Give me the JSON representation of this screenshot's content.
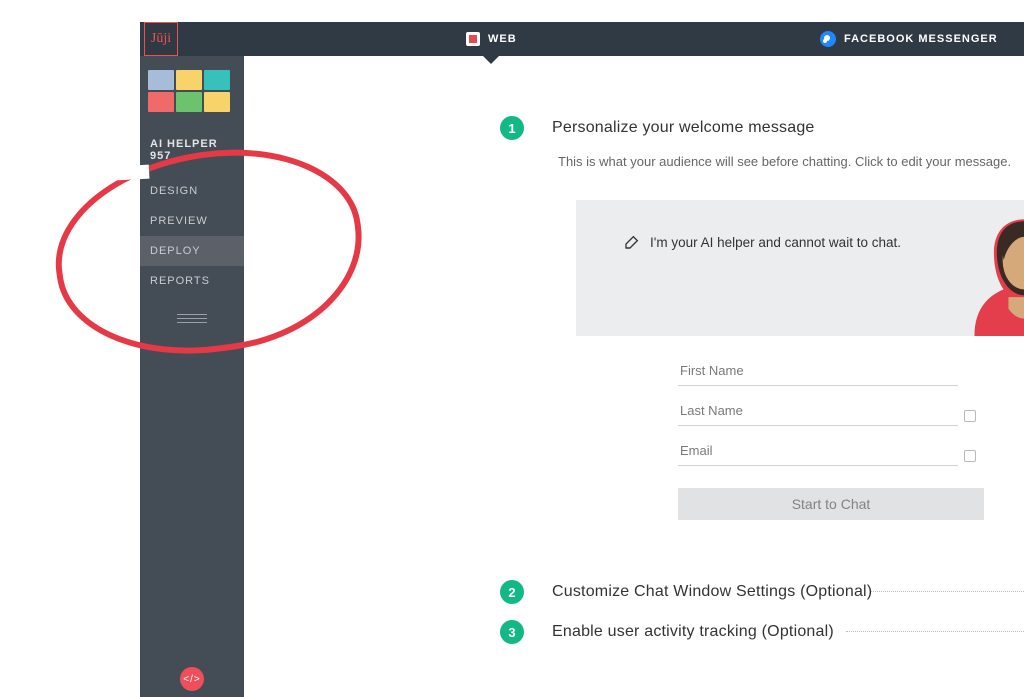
{
  "topbar": {
    "logo_text": "Jūji",
    "tab_web": "WEB",
    "tab_fb": "FACEBOOK MESSENGER"
  },
  "sidebar": {
    "app_name": "AI HELPER 957",
    "nav": {
      "design": "DESIGN",
      "preview": "PREVIEW",
      "deploy": "DEPLOY",
      "reports": "REPORTS"
    },
    "code_badge": "</>"
  },
  "steps": {
    "s1_num": "1",
    "s1_title": "Personalize your welcome message",
    "s1_help": "This is what your audience will see before chatting. Click to edit your message.",
    "s2_num": "2",
    "s2_title": "Customize Chat Window Settings (Optional)",
    "s3_num": "3",
    "s3_title": "Enable user activity tracking (Optional)"
  },
  "welcome": {
    "message": "I'm your AI helper and cannot wait to chat."
  },
  "form": {
    "first_ph": "First Name",
    "last_ph": "Last Name",
    "email_ph": "Email",
    "start_label": "Start to Chat"
  },
  "colors": {
    "accent_green": "#12b886",
    "annotation_red": "#e53946",
    "sidebar_bg": "#444d56",
    "topbar_bg": "#2f3a44"
  }
}
